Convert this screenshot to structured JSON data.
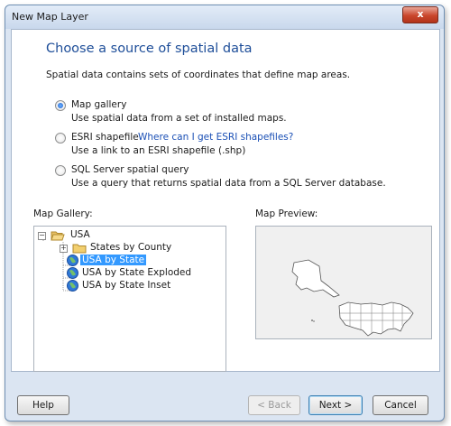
{
  "window": {
    "title": "New Map Layer",
    "close_glyph": "x"
  },
  "header": {
    "heading": "Choose a source of spatial data",
    "description": "Spatial data contains sets of coordinates that define map areas."
  },
  "options": [
    {
      "label": "Map gallery",
      "sublabel": "Use spatial data from a set of installed maps.",
      "checked": true
    },
    {
      "label": "ESRI shapefile",
      "link": "Where can I get ESRI shapefiles?",
      "sublabel": "Use a link to an ESRI shapefile (.shp)",
      "checked": false
    },
    {
      "label": "SQL Server spatial query",
      "sublabel": "Use a query that returns spatial data from a SQL Server database.",
      "checked": false
    }
  ],
  "gallery": {
    "label": "Map Gallery:",
    "root": "USA",
    "items": [
      "States by County",
      "USA by State",
      "USA by State Exploded",
      "USA by State Inset"
    ],
    "selected": "USA by State"
  },
  "preview": {
    "label": "Map Preview:"
  },
  "buttons": {
    "help": "Help",
    "back": "< Back",
    "next": "Next >",
    "cancel": "Cancel"
  }
}
